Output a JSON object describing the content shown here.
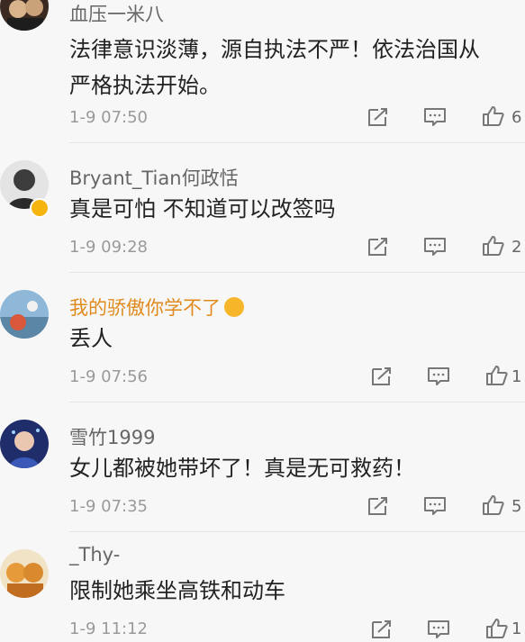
{
  "comments": [
    {
      "username": "血压一米八",
      "text_line1": "法律意识淡薄，源自执法不严！依法治国从",
      "text_line2": "严格执法开始。",
      "time": "1-9 07:50",
      "likes": "6"
    },
    {
      "username": "Bryant_Tian何政恬",
      "text_line1": "真是可怕 不知道可以改签吗",
      "time": "1-9 09:28",
      "likes": "2"
    },
    {
      "username": "我的骄傲你学不了",
      "text_line1": "丢人",
      "time": "1-9 07:56",
      "likes": "1"
    },
    {
      "username": "雪竹1999",
      "text_line1": "女儿都被她带坏了！真是无可救药！",
      "time": "1-9 07:35",
      "likes": "5"
    },
    {
      "username": "_Thy-",
      "text_line1": "限制她乘坐高铁和动车",
      "time": "1-9 11:12",
      "likes": "1"
    }
  ],
  "icons": {
    "share": "share-icon",
    "comment": "comment-icon",
    "like": "thumbs-up-icon"
  },
  "colors": {
    "vip_name": "#e08a1e",
    "verify_badge": "#f5b40e",
    "timestamp": "#9a9a9a"
  }
}
